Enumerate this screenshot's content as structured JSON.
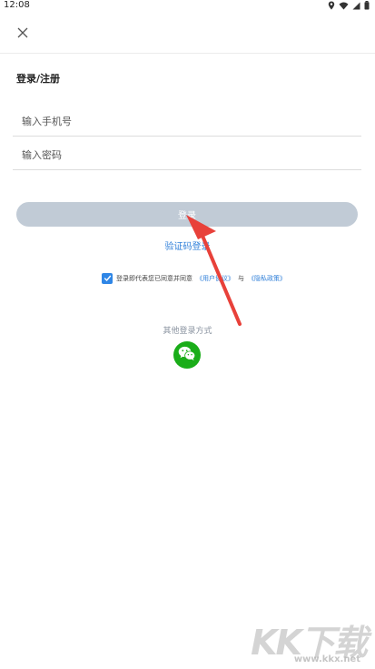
{
  "status_bar": {
    "time": "12:08",
    "icons": [
      "location-icon",
      "wifi-icon",
      "signal-icon",
      "battery-icon"
    ]
  },
  "header": {
    "close_icon": "close-icon"
  },
  "login": {
    "title": "登录/注册",
    "phone_placeholder": "输入手机号",
    "password_placeholder": "输入密码",
    "login_button": "登录",
    "sms_login_link": "验证码登录",
    "agreement": {
      "checked": true,
      "prefix_text": "登录即代表您已同意并同意",
      "user_agreement": "《用户协议》",
      "conjunction": "与",
      "privacy_policy": "《隐私政策》"
    },
    "other_methods_title": "其他登录方式",
    "other_methods": [
      "wechat-icon"
    ]
  },
  "colors": {
    "accent_blue": "#2f7fd9",
    "login_button_disabled": "#c1cbd6",
    "wechat_green": "#1aad19",
    "annotation_arrow": "#e8413a"
  },
  "watermark": {
    "brand": "KK下载",
    "url": "www.kkx.net"
  }
}
